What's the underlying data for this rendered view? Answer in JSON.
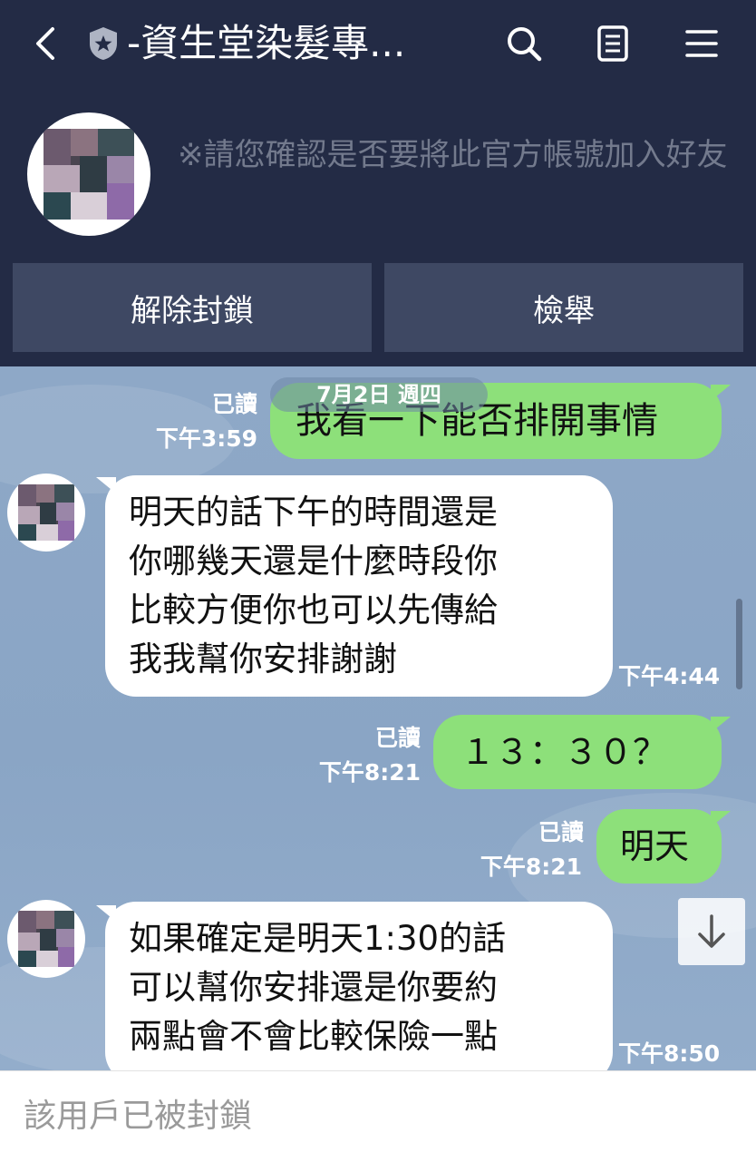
{
  "header": {
    "back_icon": "chevron-left-icon",
    "badge_icon": "official-shield-star-icon",
    "title": "-資生堂染髮專...",
    "actions": [
      "search-icon",
      "notes-icon",
      "menu-icon"
    ]
  },
  "notice": {
    "text": "※請您確認是否要將此官方帳號加入好友"
  },
  "buttons": {
    "unblock": "解除封鎖",
    "report": "檢舉"
  },
  "chat": {
    "date_chip": "7月2日 週四",
    "messages": [
      {
        "direction": "out",
        "text": "我看一下能否排開事情",
        "read": "已讀",
        "time": "下午3:59"
      },
      {
        "direction": "in",
        "lines": [
          "明天的話下午的時間還是",
          "你哪幾天還是什麼時段你",
          "比較方便你也可以先傳給",
          "我我幫你安排謝謝"
        ],
        "time": "下午4:44"
      },
      {
        "direction": "out",
        "text": "１３：３０？",
        "read": "已讀",
        "time": "下午8:21"
      },
      {
        "direction": "out",
        "text": "明天",
        "read": "已讀",
        "time": "下午8:21"
      },
      {
        "direction": "in",
        "lines": [
          "如果確定是明天1:30的話",
          "可以幫你安排還是你要約",
          "兩點會不會比較保險一點"
        ],
        "time": "下午8:50"
      }
    ],
    "scroll_down_icon": "arrow-down-icon"
  },
  "footer": {
    "blocked_text": "該用戶已被封鎖"
  },
  "colors": {
    "header_bg": "#232b45",
    "outgoing_bubble": "#8de07a",
    "incoming_bubble": "#ffffff",
    "chat_bg": "#8aa5c6"
  }
}
